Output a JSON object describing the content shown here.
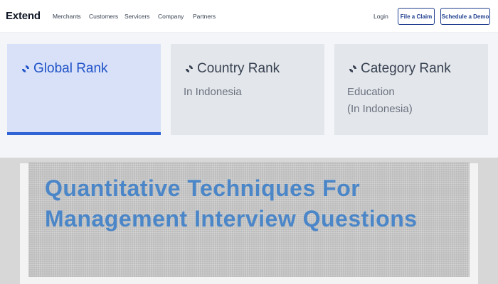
{
  "header": {
    "logo": "Extend",
    "nav": [
      "Merchants",
      "Customers",
      "Servicers",
      "Company",
      "Partners"
    ],
    "login": "Login",
    "claim_button": "File a Claim",
    "demo_button": "Schedule a Demo"
  },
  "ranks": {
    "global": {
      "title": "Global Rank",
      "active": true
    },
    "country": {
      "title": "Country Rank",
      "line1": "In Indonesia"
    },
    "category": {
      "title": "Category Rank",
      "line1": "Education",
      "line2": "(In Indonesia)"
    }
  },
  "article": {
    "title": "Quantitative Techniques For Management Interview Questions"
  },
  "colors": {
    "accent": "#2f64d6",
    "active_card": "#d8e1f7",
    "title_blue": "#4a86c8",
    "button_border": "#1f3f8f"
  },
  "icons": {
    "rank_icon": "swirl-icon"
  }
}
